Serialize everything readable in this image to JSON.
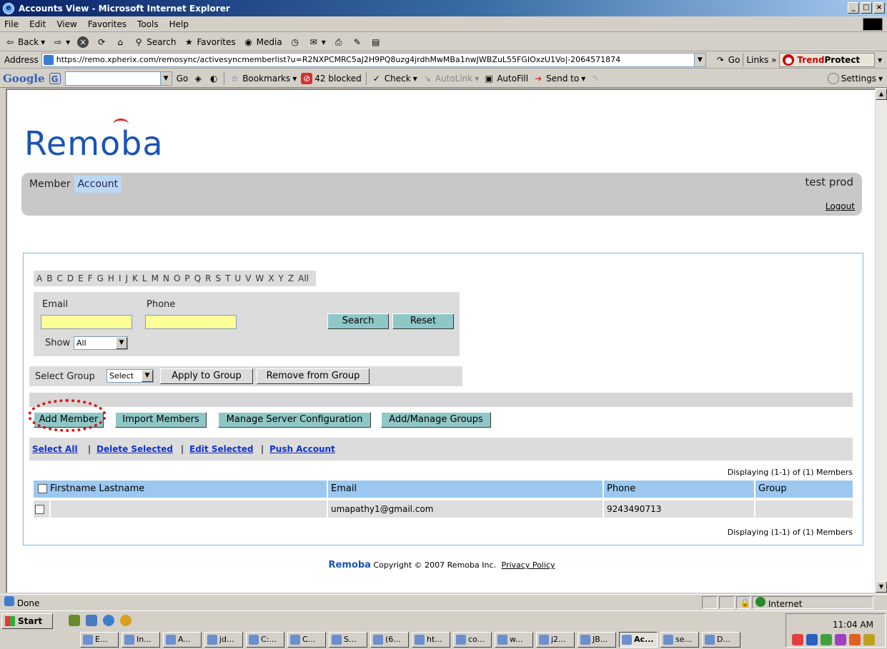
{
  "window": {
    "title": "Accounts View - Microsoft Internet Explorer",
    "min": "_",
    "max": "□",
    "close": "×"
  },
  "menu": [
    "File",
    "Edit",
    "View",
    "Favorites",
    "Tools",
    "Help"
  ],
  "toolbar": {
    "back": "Back",
    "search": "Search",
    "favorites": "Favorites",
    "media": "Media"
  },
  "address": {
    "label": "Address",
    "url": "https://remo.xpherix.com/remosync/activesyncmemberlist?u=R2NXPCMRC5aJ2H9PQ8uzg4jrdhMwMBa1nwJWBZuL55FGIOxzU1Vo|-2064571874",
    "go": "Go",
    "links": "Links",
    "trendprotect_a": "Trend",
    "trendprotect_b": "Protect"
  },
  "googlebar": {
    "logo": "Google",
    "go": "Go",
    "bookmarks": "Bookmarks",
    "blocked": "42 blocked",
    "check": "Check",
    "autolink": "AutoLink",
    "autofill": "AutoFill",
    "sendto": "Send to",
    "settings": "Settings"
  },
  "page": {
    "logo": "Remoba",
    "tabs": [
      "Member",
      "Account"
    ],
    "user": "test prod",
    "logout": "Logout",
    "letters": [
      "A",
      "B",
      "C",
      "D",
      "E",
      "F",
      "G",
      "H",
      "I",
      "J",
      "K",
      "L",
      "M",
      "N",
      "O",
      "P",
      "Q",
      "R",
      "S",
      "T",
      "U",
      "V",
      "W",
      "X",
      "Y",
      "Z",
      "All"
    ],
    "search": {
      "email_label": "Email",
      "phone_label": "Phone",
      "email_value": "",
      "phone_value": "",
      "show_label": "Show",
      "show_value": "All",
      "search_btn": "Search",
      "reset_btn": "Reset"
    },
    "group": {
      "label": "Select Group",
      "select_value": "Select",
      "apply_btn": "Apply to Group",
      "remove_btn": "Remove from Group"
    },
    "actions": {
      "add_member": "Add Member",
      "import_members": "Import Members",
      "manage_server": "Manage Server Configuration",
      "manage_groups": "Add/Manage Groups"
    },
    "links": {
      "select_all": "Select All",
      "delete_selected": "Delete Selected",
      "edit_selected": "Edit Selected",
      "push_account": "Push Account",
      "pipe": "|"
    },
    "display_text": "Displaying (1-1) of (1) Members",
    "table": {
      "headers": [
        "Firstname Lastname",
        "Email",
        "Phone",
        "Group"
      ],
      "rows": [
        {
          "name": "",
          "email": "umapathy1@gmail.com",
          "phone": "9243490713",
          "group": ""
        }
      ]
    },
    "footer": {
      "brand": "Remoba",
      "copyright": "Copyright © 2007 Remoba Inc.",
      "privacy": "Privacy Policy"
    }
  },
  "statusbar": {
    "status": "Done",
    "zone": "Internet"
  },
  "taskbar": {
    "start": "Start",
    "clock": "11:04 AM",
    "tasks": [
      "E...",
      "In...",
      "A...",
      "jd...",
      "C:...",
      "C...",
      "S...",
      "(6...",
      "ht...",
      "co...",
      "w...",
      "j2...",
      "JB...",
      "Ac...",
      "se...",
      "D..."
    ]
  },
  "colors": {
    "accent": "#1a53b8",
    "highlight_circle": "#e01010",
    "table_header": "#9cc8f0",
    "button_teal": "#8fc7c7"
  }
}
